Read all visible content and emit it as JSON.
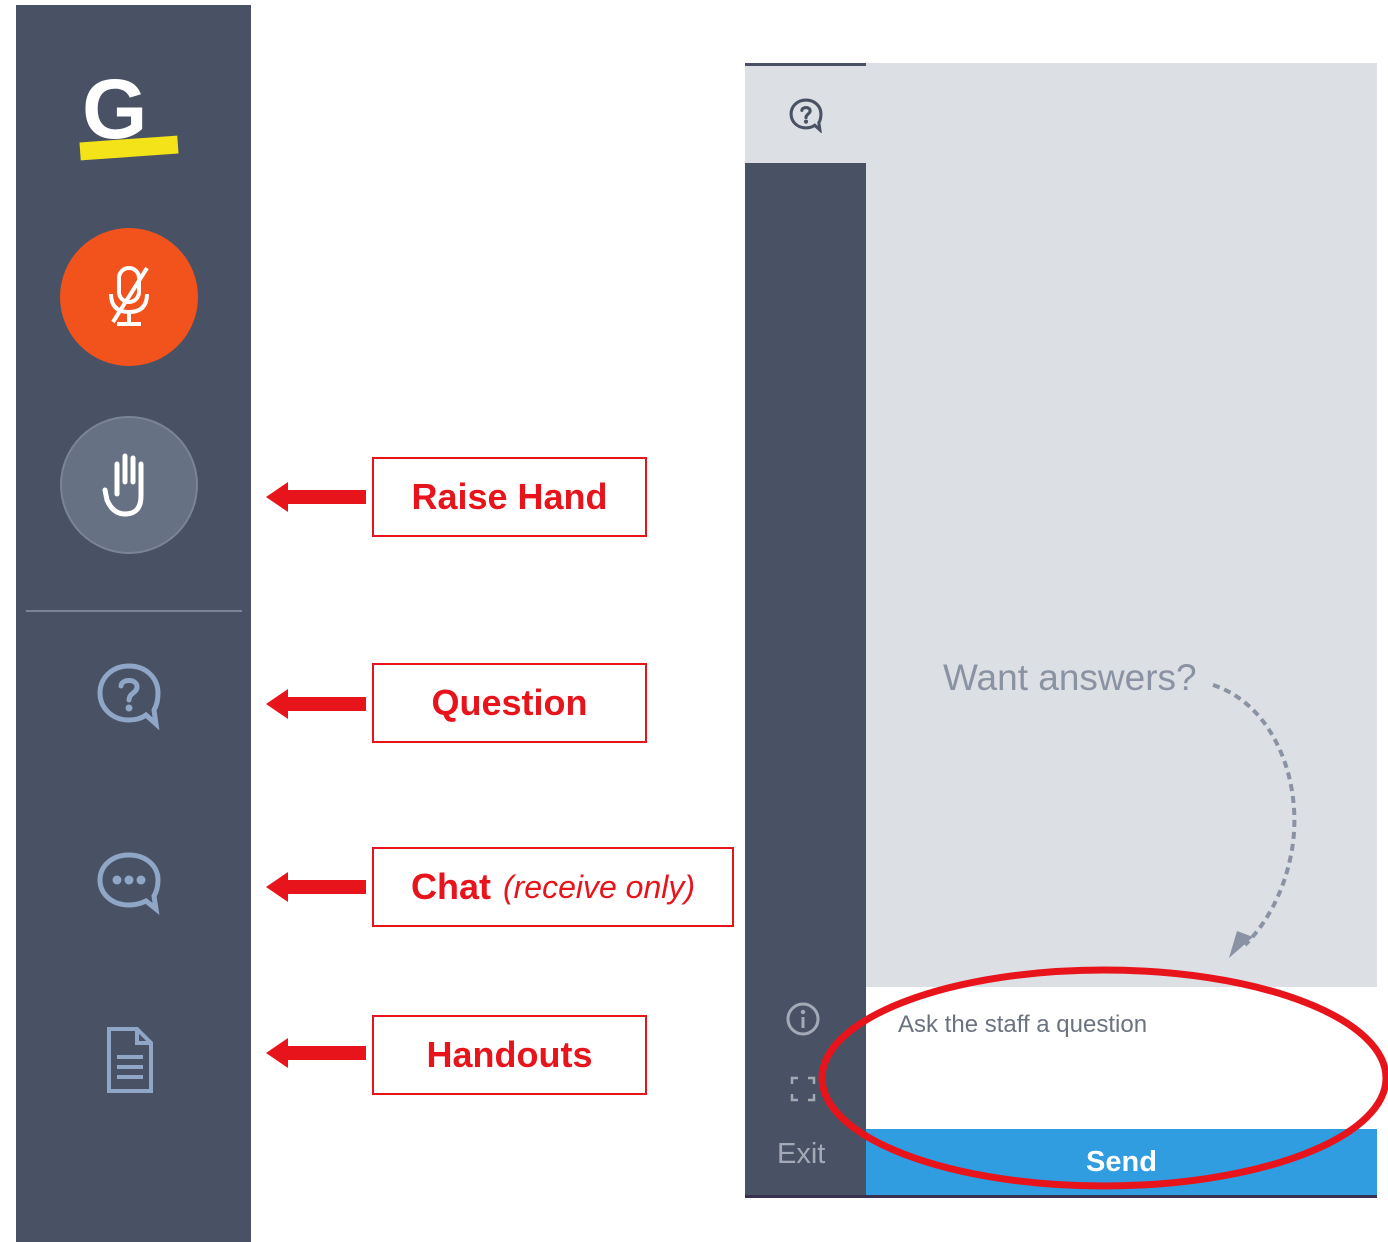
{
  "sidebar": {
    "logo_letter": "G",
    "brand_colors": {
      "logo_underline": "#f4e318",
      "mute": "#f2531c",
      "hand": "#677184",
      "sidebar": "#495264"
    },
    "icons": [
      "mic-muted-icon",
      "raise-hand-icon",
      "question-icon",
      "chat-icon",
      "handout-icon"
    ]
  },
  "annotations": {
    "raise_hand": "Raise Hand",
    "question": "Question",
    "chat": "Chat",
    "chat_note": "(receive only)",
    "handouts": "Handouts",
    "accent_color": "#e8141c"
  },
  "panel": {
    "prompt": "Want answers?",
    "input_placeholder": "Ask the staff a question",
    "send_label": "Send",
    "exit_label": "Exit",
    "send_color": "#2f9ddf"
  }
}
